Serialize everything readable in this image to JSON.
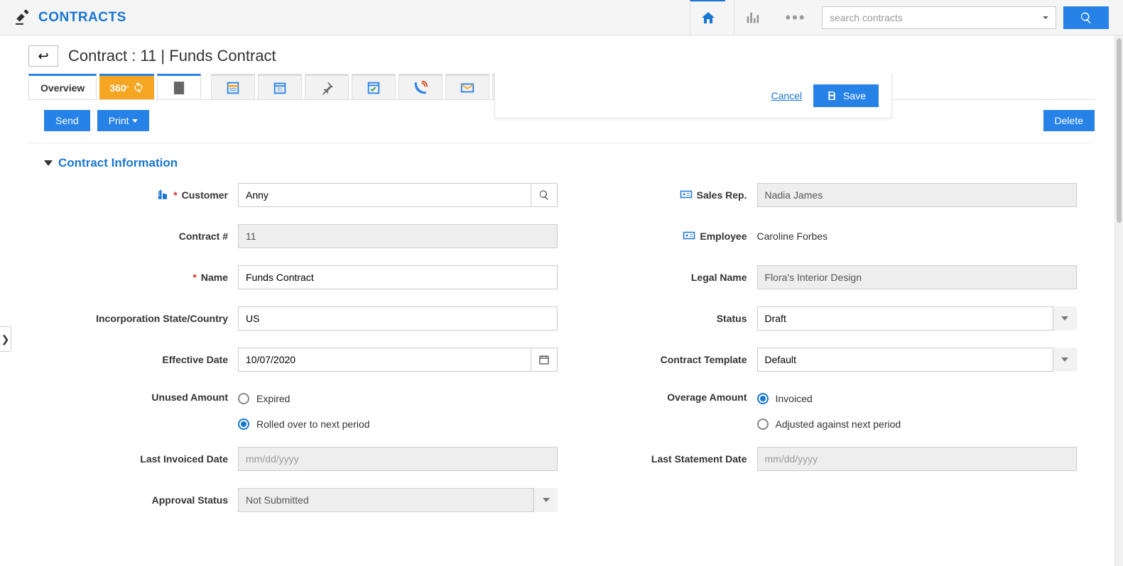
{
  "header": {
    "logo_text": "CONTRACTS",
    "search_placeholder": "search contracts"
  },
  "page": {
    "title": "Contract : 11 | Funds Contract"
  },
  "tabs": {
    "overview": "Overview",
    "three60": "360"
  },
  "actions": {
    "send": "Send",
    "print": "Print",
    "delete": "Delete",
    "cancel": "Cancel",
    "save": "Save"
  },
  "section": {
    "contract_info": "Contract Information"
  },
  "labels": {
    "customer": "Customer",
    "contract_no": "Contract #",
    "name": "Name",
    "inc_state": "Incorporation State/Country",
    "eff_date": "Effective Date",
    "unused_amt": "Unused Amount",
    "last_inv_date": "Last Invoiced Date",
    "approval_status": "Approval Status",
    "sales_rep": "Sales Rep.",
    "employee": "Employee",
    "legal_name": "Legal Name",
    "status": "Status",
    "contract_tpl": "Contract Template",
    "overage_amt": "Overage Amount",
    "last_stmt_date": "Last Statement Date"
  },
  "values": {
    "customer": "Anny",
    "contract_no": "11",
    "name": "Funds Contract",
    "inc_state": "US",
    "eff_date": "10/07/2020",
    "last_inv_date_ph": "mm/dd/yyyy",
    "approval_status": "Not Submitted",
    "sales_rep": "Nadia James",
    "employee": "Caroline Forbes",
    "legal_name": "Flora's Interior Design",
    "status": "Draft",
    "contract_tpl": "Default",
    "last_stmt_date_ph": "mm/dd/yyyy"
  },
  "radios": {
    "unused_expired": "Expired",
    "unused_rolled": "Rolled over to next period",
    "overage_invoiced": "Invoiced",
    "overage_adjusted": "Adjusted against next period"
  }
}
